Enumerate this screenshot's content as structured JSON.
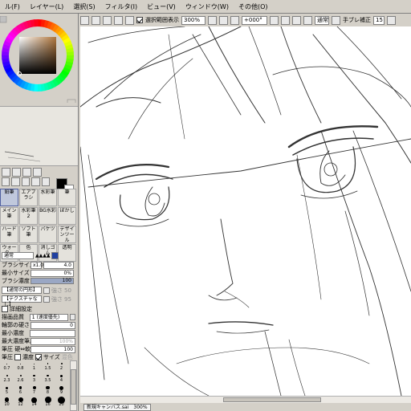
{
  "menu": [
    {
      "label": "ル(F)"
    },
    {
      "label": "レイヤー(L)"
    },
    {
      "label": "選択(S)"
    },
    {
      "label": "フィルタ(I)"
    },
    {
      "label": "ビュー(V)"
    },
    {
      "label": "ウィンドウ(W)"
    },
    {
      "label": "その他(O)"
    }
  ],
  "toolbar": {
    "show_selection_label": "選択範囲表示",
    "show_selection_checked": true,
    "zoom": "300%",
    "rotation": "+000°",
    "mode": "通常",
    "stabilizer_label": "手ブレ補正",
    "stabilizer_value": "15"
  },
  "tools": [
    {
      "label": "鉛筆",
      "selected": true
    },
    {
      "label": "エアブラシ",
      "selected": false
    },
    {
      "label": "水彩筆",
      "selected": false
    },
    {
      "label": "筆",
      "selected": false
    },
    {
      "label": "メイン筆",
      "selected": false
    },
    {
      "label": "水彩筆2",
      "selected": false
    },
    {
      "label": "BG水彩",
      "selected": false
    },
    {
      "label": "ぼかし",
      "selected": false
    },
    {
      "label": "ハード筆",
      "selected": false
    },
    {
      "label": "ソフト筆",
      "selected": false
    },
    {
      "label": "バケツ",
      "selected": false
    },
    {
      "label": "デザインツール",
      "selected": false
    },
    {
      "label": "ウォーター",
      "selected": false
    },
    {
      "label": "色",
      "selected": false
    },
    {
      "label": "消しゴム",
      "selected": false
    },
    {
      "label": "透明",
      "selected": false
    }
  ],
  "brush": {
    "blend_mode": "通常",
    "size_label": "ブラシサイズ",
    "size_multiplier": "x1.0",
    "size_value": "4.0",
    "min_size_label": "最小サイズ",
    "min_size_value": "0%",
    "density_label": "ブラシ濃度",
    "density_value": "100",
    "density_fraction": 1.0,
    "shape_label": "【通常の円形】",
    "texture_label": "【テクスチャなし】",
    "strength_label": "強さ",
    "strength_value": "50",
    "strength_value_2": "95",
    "advanced_label": "詳細設定",
    "quality_label": "描画品質",
    "quality_value": "1 (速度優先)",
    "edge_label": "輪郭の硬さ",
    "edge_value": "0",
    "min_density_label": "最小濃度",
    "max_density_label": "最大濃度筆圧",
    "max_density_value": "100%",
    "pressure_label": "筆圧 硬⇔軟",
    "pressure_value": "100",
    "pressure_toggle_label": "筆圧",
    "pressure_density_label": "濃度",
    "pressure_size_label": "サイズ",
    "pressure_blend_label": "混色"
  },
  "brush_sizes": [
    [
      "0.7",
      "0.8",
      "1",
      "1.5",
      "2"
    ],
    [
      "2.3",
      "2.6",
      "3",
      "3.5",
      "4"
    ],
    [
      "5",
      "6",
      "7",
      "8",
      "9"
    ],
    [
      "10",
      "12",
      "14",
      "16",
      "20"
    ]
  ],
  "document": {
    "name": "新規キャンバス.sai",
    "zoom": "300%"
  },
  "colors": {
    "foreground": "#000000",
    "background": "#ffffff",
    "picker_hue": "#b0763c"
  }
}
